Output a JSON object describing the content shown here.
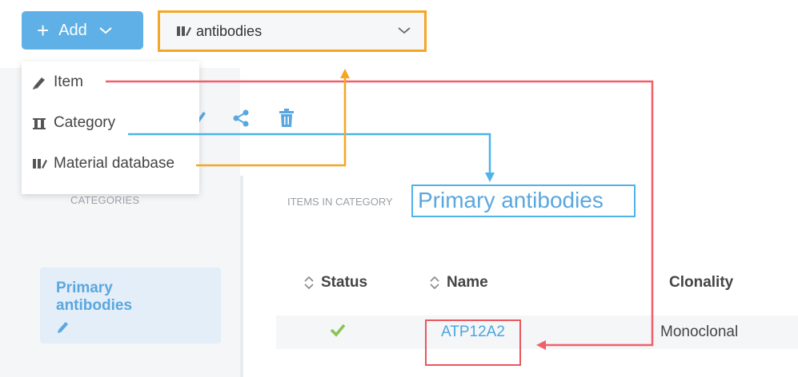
{
  "add_button": {
    "plus": "+",
    "label": "Add",
    "icon": "chevron-down-icon"
  },
  "database_select": {
    "value": "antibodies",
    "icon": "flask-icon"
  },
  "dropdown_menu": {
    "items": [
      {
        "label": "Item",
        "icon": "pencil-icon"
      },
      {
        "label": "Category",
        "icon": "category-icon"
      },
      {
        "label": "Material database",
        "icon": "flask-icon"
      }
    ]
  },
  "toolbar": {
    "icons": [
      "share-icon",
      "trash-icon"
    ]
  },
  "categories": {
    "label": "CATEGORIES",
    "items": [
      {
        "name_line1": "Primary",
        "name_line2": "antibodies",
        "icon": "edit-icon"
      }
    ]
  },
  "items_panel": {
    "label": "ITEMS IN CATEGORY",
    "category_title": "Primary antibodies",
    "columns": [
      "Status",
      "Name",
      "Clonality"
    ],
    "rows": [
      {
        "status": "check",
        "name": "ATP12A2",
        "clonality": "Monoclonal"
      }
    ]
  },
  "annotation_colors": {
    "red": "#f0606a",
    "blue": "#4fb3e8",
    "orange": "#f5a623"
  }
}
